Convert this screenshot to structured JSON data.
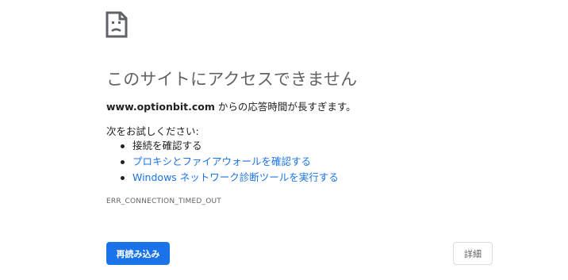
{
  "icon": "sad-document-icon",
  "title": "このサイトにアクセスできません",
  "summary": {
    "host": "www.optionbit.com",
    "message": " からの応答時間が長すぎます。"
  },
  "suggestions": {
    "heading": "次をお試しください:",
    "items": [
      {
        "label": "接続を確認する",
        "is_link": false
      },
      {
        "label": "プロキシとファイアウォールを確認する",
        "is_link": true
      },
      {
        "label": "Windows ネットワーク診断ツールを実行する",
        "is_link": true
      }
    ]
  },
  "error_code": "ERR_CONNECTION_TIMED_OUT",
  "buttons": {
    "reload_label": "再読み込み",
    "details_label": "詳細"
  },
  "colors": {
    "accent": "#1a73e8",
    "title": "#5f6368",
    "text": "#202124"
  }
}
